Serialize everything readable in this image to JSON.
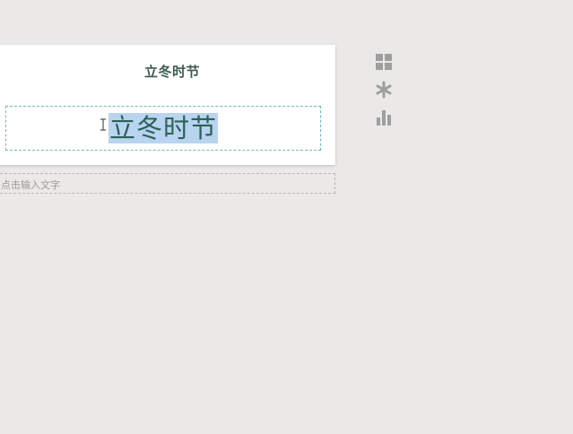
{
  "card": {
    "title": "立冬时节",
    "edit_text": "立冬时节"
  },
  "input": {
    "placeholder": "点击输入文字"
  },
  "toolbar": {
    "icons": [
      "grid-icon",
      "asterisk-icon",
      "bar-chart-icon"
    ]
  },
  "colors": {
    "background": "#ebe9e7",
    "title": "#3b5b50",
    "selection": "#b8d4f0",
    "edit_border": "#6fb7c8",
    "icon": "#9e9e9e"
  }
}
